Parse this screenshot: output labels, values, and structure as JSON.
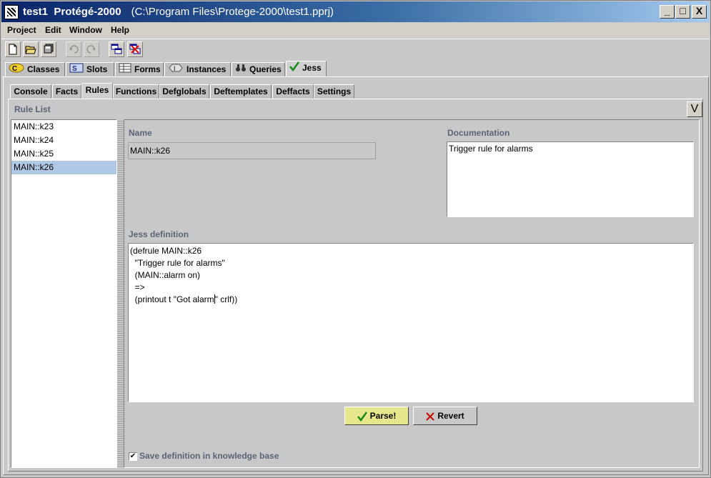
{
  "window": {
    "title": "test1  Protégé-2000",
    "path": "(C:\\Program Files\\Protege-2000\\test1.pprj)",
    "minimize": "_",
    "maximize": "□",
    "close": "X"
  },
  "menu": [
    "Project",
    "Edit",
    "Window",
    "Help"
  ],
  "toolbar": {
    "icons": [
      "new-file-icon",
      "open-folder-icon",
      "save-icon",
      "undo-icon",
      "redo-icon",
      "copy-windows-icon",
      "close-windows-icon"
    ]
  },
  "main_tabs": [
    {
      "label": "Classes",
      "icon": "classes-icon",
      "active": false
    },
    {
      "label": "Slots",
      "icon": "slots-icon",
      "active": false
    },
    {
      "label": "Forms",
      "icon": "forms-icon",
      "active": false
    },
    {
      "label": "Instances",
      "icon": "instances-icon",
      "active": false
    },
    {
      "label": "Queries",
      "icon": "binoculars-icon",
      "active": false
    },
    {
      "label": "Jess",
      "icon": "checkmark-icon",
      "active": true
    }
  ],
  "sub_tabs": [
    "Console",
    "Facts",
    "Rules",
    "Functions",
    "Defglobals",
    "Deftemplates",
    "Deffacts",
    "Settings"
  ],
  "active_sub_tab": "Rules",
  "rule_list": {
    "label": "Rule List",
    "toggle": "V",
    "items": [
      "MAIN::k23",
      "MAIN::k24",
      "MAIN::k25",
      "MAIN::k26"
    ],
    "selected": "MAIN::k26"
  },
  "detail": {
    "name_label": "Name",
    "name_value": "MAIN::k26",
    "doc_label": "Documentation",
    "doc_value": "Trigger rule for alarms",
    "jess_label": "Jess definition",
    "jess_lines": [
      "(defrule MAIN::k26",
      "  \"Trigger rule for alarms\"",
      "  (MAIN::alarm on)",
      "  =>",
      "  (printout t \"Got alarm",
      "\" crlf))"
    ],
    "parse_label": "Parse!",
    "revert_label": "Revert",
    "save_checkbox_label": "Save definition in knowledge base",
    "save_checked": true
  },
  "colors": {
    "title_start": "#0a246a",
    "title_end": "#a6caf0",
    "selection": "#b0c8e6",
    "default_button": "#e6e68c",
    "label": "#5a6478"
  }
}
